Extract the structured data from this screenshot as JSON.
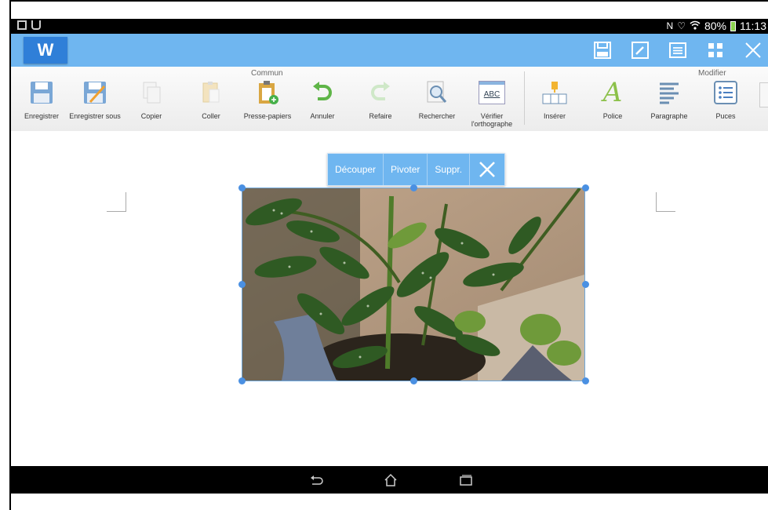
{
  "statusbar": {
    "battery": "80%",
    "time": "11:13"
  },
  "app": {
    "logo": "W"
  },
  "ribbon": {
    "groups": {
      "commun": "Commun",
      "modifier": "Modifier"
    },
    "items": [
      {
        "label": "Enregistrer"
      },
      {
        "label": "Enregistrer sous"
      },
      {
        "label": "Copier"
      },
      {
        "label": "Coller"
      },
      {
        "label": "Presse-papiers"
      },
      {
        "label": "Annuler"
      },
      {
        "label": "Refaire"
      },
      {
        "label": "Rechercher"
      },
      {
        "label": "Vérifier l'orthographe"
      },
      {
        "label": "Insérer"
      },
      {
        "label": "Police"
      },
      {
        "label": "Paragraphe"
      },
      {
        "label": "Puces"
      }
    ],
    "spellcheck_icon_text": "ABC",
    "font_icon_text": "A"
  },
  "image_toolbar": {
    "cut": "Découper",
    "rotate": "Pivoter",
    "delete": "Suppr."
  },
  "colors": {
    "appbar": "#6fb6f0",
    "accent": "#2f7fd8"
  }
}
